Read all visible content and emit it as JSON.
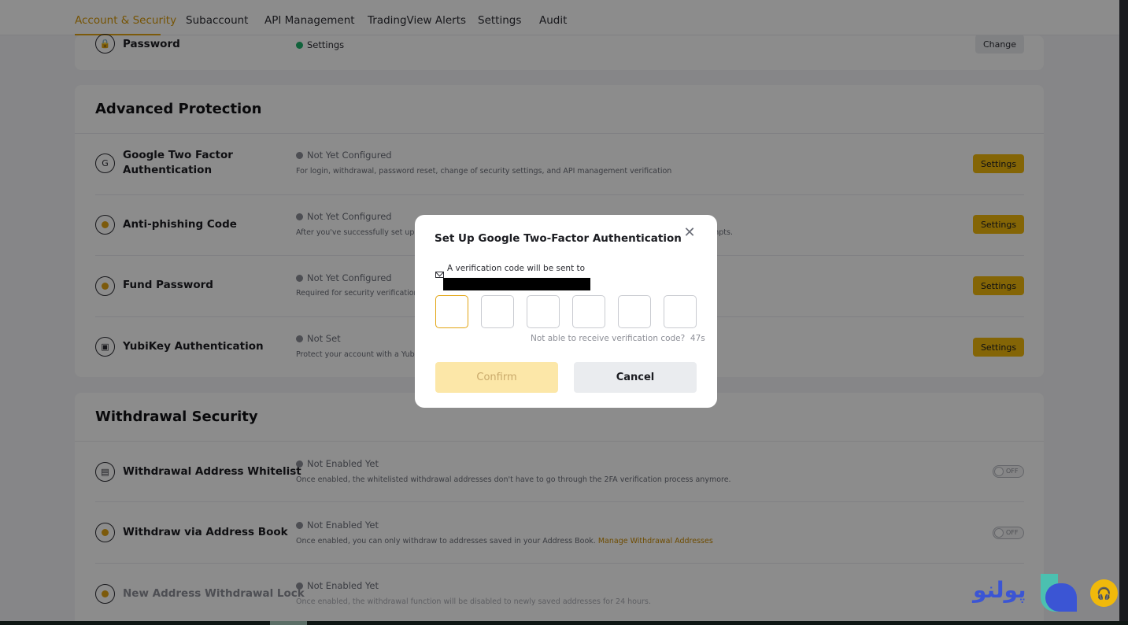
{
  "nav": {
    "tabs": [
      {
        "label": "Account & Security",
        "active": true
      },
      {
        "label": "Subaccount"
      },
      {
        "label": "API Management"
      },
      {
        "label": "TradingView Alerts"
      },
      {
        "label": "Settings"
      },
      {
        "label": "Audit"
      }
    ]
  },
  "password_row": {
    "label": "Password",
    "status": "Settings",
    "button": "Change"
  },
  "advanced": {
    "title": "Advanced Protection",
    "rows": [
      {
        "label": "Google Two Factor Authentication",
        "status": "Not Yet Configured",
        "desc": "For login, withdrawal, password reset, change of security settings, and API management verification",
        "button": "Settings"
      },
      {
        "label": "Anti-phishing Code",
        "status": "Not Yet Configured",
        "desc": "After you've successfully set up the",
        "desc_tail": "mpts.",
        "button": "Settings"
      },
      {
        "label": "Fund Password",
        "status": "Not Yet Configured",
        "desc": "Required for security verification ar",
        "button": "Settings"
      },
      {
        "label": "YubiKey Authentication",
        "status": "Not Set",
        "desc": "Protect your account with a YubiKe",
        "button": "Settings"
      }
    ]
  },
  "withdrawal": {
    "title": "Withdrawal Security",
    "rows": [
      {
        "label": "Withdrawal Address Whitelist",
        "status": "Not Enabled Yet",
        "desc": "Once enabled, the whitelisted withdrawal addresses don't have to go through the 2FA verification process anymore.",
        "toggle": "OFF"
      },
      {
        "label": "Withdraw via Address Book",
        "status": "Not Enabled Yet",
        "desc": "Once enabled, you can only withdraw to addresses saved in your Address Book.",
        "link": "Manage Withdrawal Addresses",
        "toggle": "OFF"
      },
      {
        "label": "New Address Withdrawal Lock",
        "status": "Not Enabled Yet",
        "desc": "Once enabled, the withdrawal function will be disabled to newly saved addresses for 24 hours."
      }
    ]
  },
  "modal": {
    "title": "Set Up Google Two-Factor Authentication",
    "sent_text": "A verification code will be sent to",
    "resend_text": "Not able to receive verification code?",
    "countdown": "47s",
    "confirm": "Confirm",
    "cancel": "Cancel"
  },
  "watermark": {
    "text": "پولنو"
  },
  "colors": {
    "accent": "#f0b90b",
    "active_tab": "#d89a0a",
    "link": "#c98a00",
    "success": "#20b26c"
  }
}
